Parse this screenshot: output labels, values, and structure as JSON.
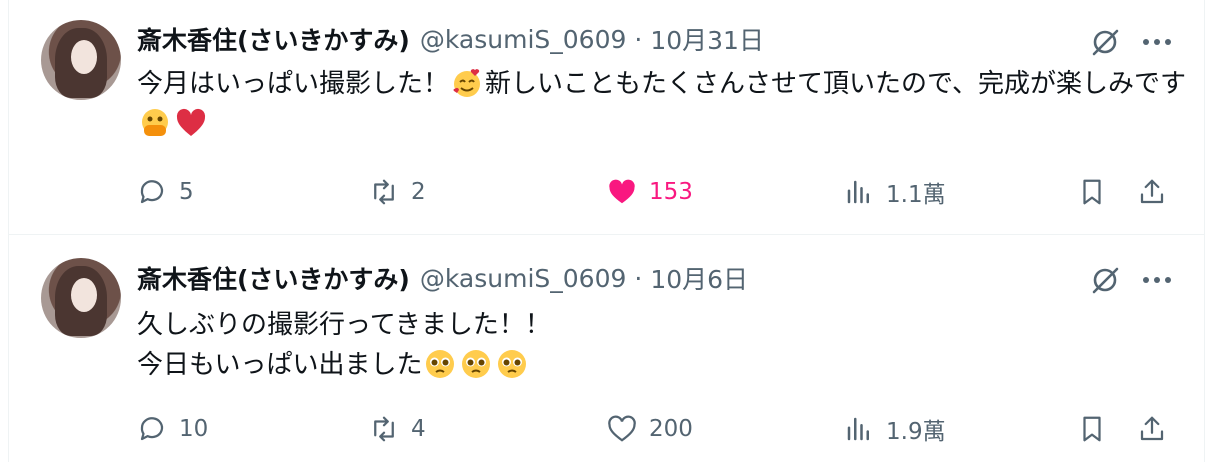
{
  "tweets": [
    {
      "author_name": "斎木香住(さいきかすみ)",
      "handle": "@kasumiS_0609",
      "separator": "·",
      "date": "10月31日",
      "text_part1": "今月はいっぱい撮影した！",
      "emoji1": "smiling-face-with-hearts",
      "text_part2": "新しいこともたくさんさせて頂いたので、完成が楽しみです",
      "emoji2": "face-with-open-eyes-and-hand-over-mouth",
      "emoji3": "red-heart",
      "replies": "5",
      "reposts": "2",
      "likes": "153",
      "liked": true,
      "views": "1.1萬"
    },
    {
      "author_name": "斎木香住(さいきかすみ)",
      "handle": "@kasumiS_0609",
      "separator": "·",
      "date": "10月6日",
      "line1": "久しぶりの撮影行ってきました！！",
      "line2": "今日もいっぱい出ました",
      "emoji": "pleading-face",
      "replies": "10",
      "reposts": "4",
      "likes": "200",
      "liked": false,
      "views": "1.9萬"
    }
  ],
  "colors": {
    "text": "#0f1419",
    "muted": "#536471",
    "like": "#f91880",
    "border": "#eff3f4"
  },
  "icons": [
    "grok-icon",
    "more-icon",
    "reply-icon",
    "repost-icon",
    "like-icon",
    "views-icon",
    "bookmark-icon",
    "share-icon"
  ]
}
